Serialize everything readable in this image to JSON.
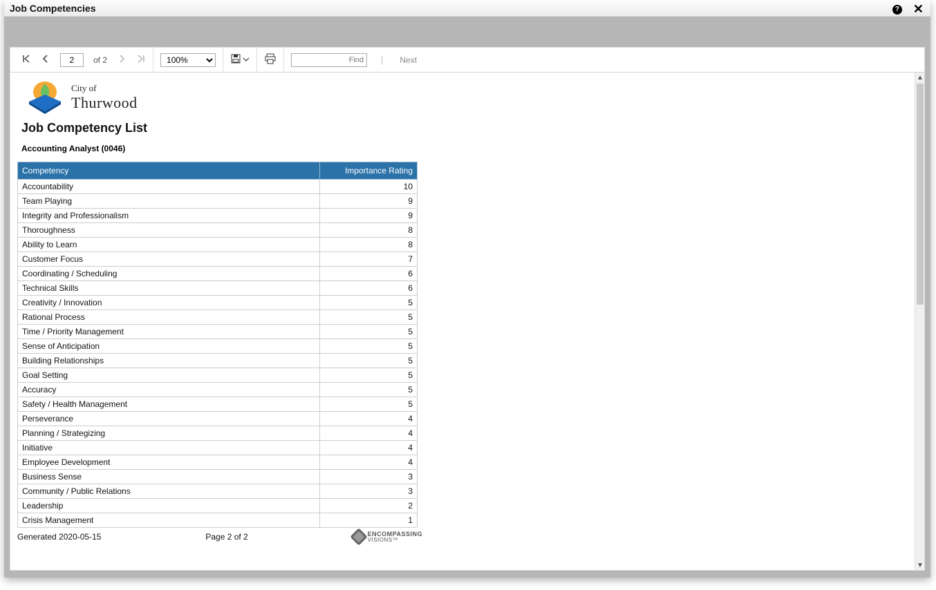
{
  "window": {
    "title": "Job Competencies"
  },
  "toolbar": {
    "page_input": "2",
    "of_label": "of 2",
    "zoom": "100%",
    "find_placeholder": "Find",
    "next_label": "Next"
  },
  "logo": {
    "line1": "City of",
    "line2": "Thurwood"
  },
  "report": {
    "title": "Job Competency List",
    "subtitle": "Accounting Analyst (0046)",
    "columns": {
      "competency": "Competency",
      "rating": "Importance Rating"
    },
    "rows": [
      {
        "name": "Accountability",
        "rating": 10
      },
      {
        "name": "Team Playing",
        "rating": 9
      },
      {
        "name": "Integrity and Professionalism",
        "rating": 9
      },
      {
        "name": "Thoroughness",
        "rating": 8
      },
      {
        "name": "Ability to Learn",
        "rating": 8
      },
      {
        "name": "Customer Focus",
        "rating": 7
      },
      {
        "name": "Coordinating / Scheduling",
        "rating": 6
      },
      {
        "name": "Technical Skills",
        "rating": 6
      },
      {
        "name": "Creativity / Innovation",
        "rating": 5
      },
      {
        "name": "Rational Process",
        "rating": 5
      },
      {
        "name": "Time / Priority Management",
        "rating": 5
      },
      {
        "name": "Sense of Anticipation",
        "rating": 5
      },
      {
        "name": "Building Relationships",
        "rating": 5
      },
      {
        "name": "Goal Setting",
        "rating": 5
      },
      {
        "name": "Accuracy",
        "rating": 5
      },
      {
        "name": "Safety / Health Management",
        "rating": 5
      },
      {
        "name": "Perseverance",
        "rating": 4
      },
      {
        "name": "Planning / Strategizing",
        "rating": 4
      },
      {
        "name": "Initiative",
        "rating": 4
      },
      {
        "name": "Employee Development",
        "rating": 4
      },
      {
        "name": "Business Sense",
        "rating": 3
      },
      {
        "name": "Community / Public Relations",
        "rating": 3
      },
      {
        "name": "Leadership",
        "rating": 2
      },
      {
        "name": "Crisis Management",
        "rating": 1
      }
    ],
    "footer": {
      "generated": "Generated 2020-05-15",
      "page_label": "Page 2 of 2",
      "brand1": "ENCOMPASSING",
      "brand2": "VISIONS™"
    }
  }
}
